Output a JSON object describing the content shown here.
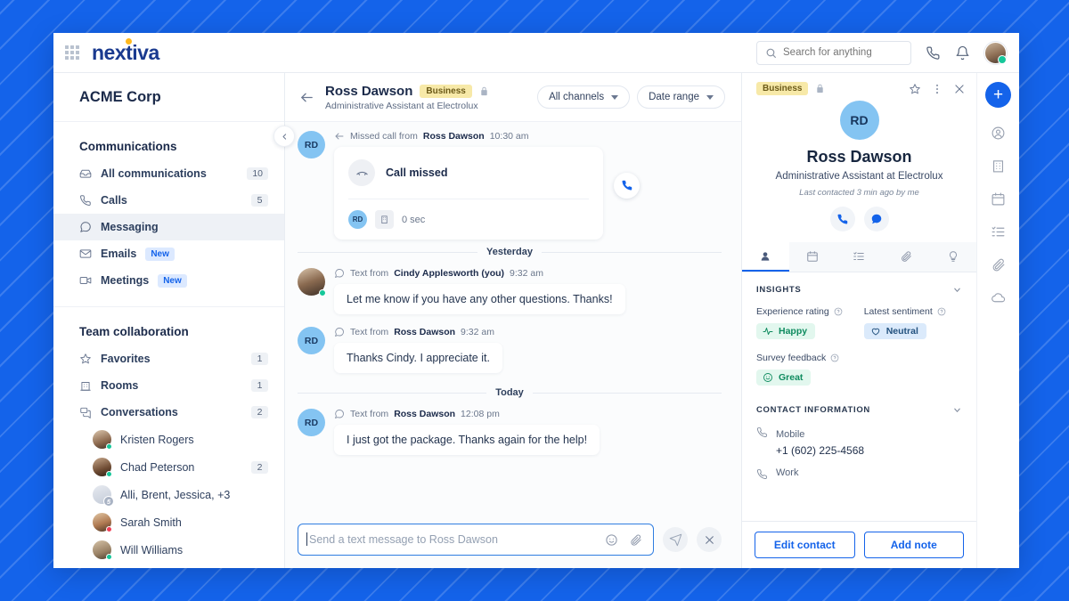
{
  "topbar": {
    "brand": "nextiva",
    "search_placeholder": "Search for anything",
    "icons": [
      "grid-icon",
      "phone-icon",
      "bell-icon",
      "user-avatar"
    ]
  },
  "sidebar": {
    "org_name": "ACME Corp",
    "sections": [
      {
        "title": "Communications",
        "items": [
          {
            "label": "All communications",
            "icon": "inbox-icon",
            "count": "10",
            "active": false
          },
          {
            "label": "Calls",
            "icon": "phone-icon",
            "count": "5",
            "active": false
          },
          {
            "label": "Messaging",
            "icon": "chat-icon",
            "count": "",
            "active": true
          },
          {
            "label": "Emails",
            "icon": "envelope-icon",
            "count": "",
            "tag": "New",
            "active": false
          },
          {
            "label": "Meetings",
            "icon": "video-icon",
            "count": "",
            "tag": "New",
            "active": false
          }
        ]
      },
      {
        "title": "Team collaboration",
        "items": [
          {
            "label": "Favorites",
            "icon": "star-icon",
            "count": "1"
          },
          {
            "label": "Rooms",
            "icon": "building-icon",
            "count": "1"
          },
          {
            "label": "Conversations",
            "icon": "conversations-icon",
            "count": "2"
          }
        ]
      }
    ],
    "conversations": [
      {
        "label": "Kristen Rogers",
        "count": "",
        "presence": "#16c79a",
        "avatar_color": "#8d6a4f"
      },
      {
        "label": "Chad Peterson",
        "count": "2",
        "presence": "#16c79a",
        "avatar_color": "#6e4b33"
      },
      {
        "label": "Alli, Brent, Jessica, +3",
        "count": "",
        "group": "5",
        "avatar_color": "#c3cbd8"
      },
      {
        "label": "Sarah Smith",
        "count": "",
        "presence": "#ef3e56",
        "avatar_color": "#b07a52"
      },
      {
        "label": "Will Williams",
        "count": "",
        "presence": "#16c79a",
        "avatar_color": "#9a8266"
      }
    ]
  },
  "conversation": {
    "back_icon": "back-arrow-icon",
    "name": "Ross Dawson",
    "badge": "Business",
    "lock_icon": "lock-icon",
    "subtitle": "Administrative Assistant at Electrolux",
    "filters": [
      {
        "label": "All channels"
      },
      {
        "label": "Date range"
      }
    ],
    "messages": [
      {
        "type": "call",
        "avatar_initials": "RD",
        "meta_prefix": "Missed call from",
        "meta_name": "Ross Dawson",
        "meta_time": "10:30 am",
        "card_title": "Call missed",
        "card_initials": "RD",
        "card_duration": "0 sec"
      },
      {
        "type": "day",
        "label": "Yesterday"
      },
      {
        "type": "text",
        "avatar_kind": "photo",
        "meta_prefix": "Text from",
        "meta_name": "Cindy Applesworth (you)",
        "meta_time": "9:32 am",
        "body": "Let me know if you have any other questions. Thanks!"
      },
      {
        "type": "text",
        "avatar_initials": "RD",
        "meta_prefix": "Text from",
        "meta_name": "Ross Dawson",
        "meta_time": "9:32 am",
        "body": "Thanks Cindy. I appreciate it."
      },
      {
        "type": "day",
        "label": "Today"
      },
      {
        "type": "text",
        "avatar_initials": "RD",
        "meta_prefix": "Text from",
        "meta_name": "Ross Dawson",
        "meta_time": "12:08 pm",
        "body": "I just got the package. Thanks again for the help!"
      }
    ],
    "composer": {
      "placeholder": "Send a text message to Ross Dawson",
      "emoji_icon": "emoji-icon",
      "attach_icon": "paperclip-icon",
      "send_icon": "send-icon",
      "close_icon": "close-icon"
    }
  },
  "contact_panel": {
    "badge": "Business",
    "lock_icon": "lock-icon",
    "header_icons": [
      "star-icon",
      "more-vertical-icon",
      "close-icon"
    ],
    "avatar_initials": "RD",
    "name": "Ross Dawson",
    "role": "Administrative Assistant at Electrolux",
    "last_contacted": "Last contacted 3 min ago by me",
    "quick_actions": [
      "phone-icon",
      "chat-icon"
    ],
    "tabs": [
      {
        "icon": "person-icon",
        "active": true
      },
      {
        "icon": "calendar-icon",
        "active": false
      },
      {
        "icon": "tasks-icon",
        "active": false
      },
      {
        "icon": "paperclip-icon",
        "active": false
      },
      {
        "icon": "insights-icon",
        "active": false
      }
    ],
    "insights": {
      "title": "INSIGHTS",
      "experience_rating": {
        "label": "Experience rating",
        "value": "Happy",
        "icon": "pulse-icon",
        "color": "#0f8b5f"
      },
      "latest_sentiment": {
        "label": "Latest sentiment",
        "value": "Neutral",
        "icon": "heart-icon",
        "color": "#23527f"
      },
      "survey_feedback": {
        "label": "Survey feedback",
        "value": "Great",
        "icon": "smiley-icon",
        "color": "#0f8b5f"
      }
    },
    "contact_information": {
      "title": "CONTACT INFORMATION",
      "rows": [
        {
          "label": "Mobile",
          "value": "+1 (602) 225-4568",
          "icon": "phone-icon"
        },
        {
          "label": "Work",
          "value": "",
          "icon": "phone-icon"
        }
      ]
    },
    "footer_buttons": [
      {
        "label": "Edit contact"
      },
      {
        "label": "Add note"
      }
    ]
  },
  "rail": {
    "add_label": "+",
    "icons": [
      "contact-icon",
      "building-icon",
      "calendar-icon",
      "tasks-icon",
      "paperclip-icon",
      "cloud-icon"
    ]
  },
  "colors": {
    "brand_blue": "#1463ea",
    "navy": "#1b2a4a",
    "avatar_blue": "#84c4f2",
    "badge_yellow": "#f7e9a8",
    "green": "#16c79a",
    "red": "#ef3e56"
  }
}
